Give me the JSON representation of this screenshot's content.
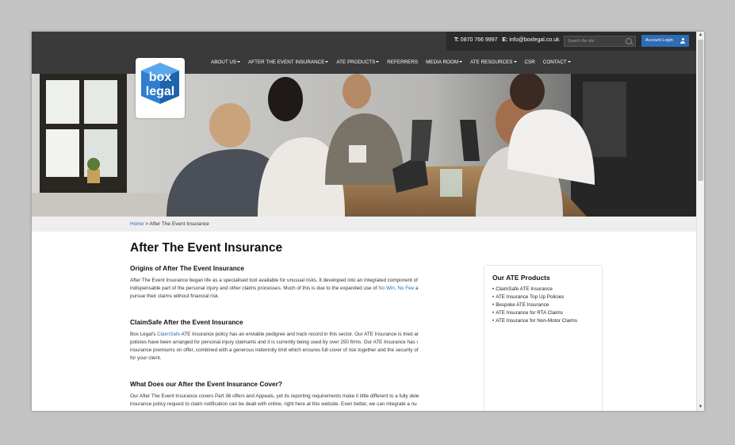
{
  "header": {
    "phone_label": "T:",
    "phone": "0870 766 9997",
    "email_label": "E:",
    "email": "info@boxlegal.co.uk",
    "search_placeholder": "Search the site",
    "account_login": "Account Login"
  },
  "logo": {
    "line1": "box",
    "line2": "legal",
    "color": "#2f7fd1"
  },
  "nav": {
    "items": [
      {
        "label": "ABOUT US",
        "dropdown": true
      },
      {
        "label": "AFTER THE EVENT INSURANCE",
        "dropdown": true
      },
      {
        "label": "ATE PRODUCTS",
        "dropdown": true
      },
      {
        "label": "REFERRERS",
        "dropdown": false
      },
      {
        "label": "MEDIA ROOM",
        "dropdown": true
      },
      {
        "label": "ATE RESOURCES",
        "dropdown": true
      },
      {
        "label": "CSR",
        "dropdown": false
      },
      {
        "label": "CONTACT",
        "dropdown": true
      }
    ]
  },
  "breadcrumb": {
    "home": "Home",
    "separator": ">",
    "current": "After The Event Insurance"
  },
  "main": {
    "title": "After The Event Insurance",
    "sections": [
      {
        "heading": "Origins of After The Event Insurance",
        "lines": [
          [
            "After The Event Insurance began life as a specialised tool available for unusual risks. It developed into an integrated component of"
          ],
          [
            "indispensable part of the personal injury and other claims processes. Much of this is due to the expanded use of ",
            "No Win, No Fee",
            " a"
          ],
          [
            "pursue their claims without financial risk."
          ]
        ]
      },
      {
        "heading": "ClaimSafe After the Event Insurance",
        "lines": [
          [
            "Box Legal's ",
            "ClaimSafe",
            " ATE Insurance policy has an enviable pedigree and track record in this sector. Our ATE Insurance is tried ar"
          ],
          [
            "policies have been arranged for personal injury claimants and it is currently being used by over 250 firms. Our ATE Insurance has i"
          ],
          [
            "insurance premiums on offer, combined with a generous indemnity limit which ensures full cover of risk together and the security of"
          ],
          [
            "for your client."
          ]
        ]
      },
      {
        "heading": "What Does our After the Event Insurance Cover?",
        "lines": [
          [
            "Our After The Event Insurance covers Part 36 offers and Appeals, yet its reporting requirements make it little different to a fully dele"
          ],
          [
            "insurance policy request to claim notification can be dealt with online, right here at this website. Even better, we can integrate a nu"
          ]
        ]
      }
    ]
  },
  "sidebar": {
    "title": "Our ATE Products",
    "items": [
      "ClaimSafe ATE Insurance",
      "ATE Insurance Top Up Policies",
      "Bespoke ATE Insurance",
      "ATE Insurance for RTA Claims",
      "ATE Insurance for Non-Motor Claims"
    ]
  },
  "colors": {
    "header_bg": "#3a3a3a",
    "topbar_bg": "#2b2b2b",
    "accent": "#2e6cb3",
    "breadcrumb_bg": "#eeeeee"
  },
  "hero": {
    "image": "office-team-working-photo"
  }
}
